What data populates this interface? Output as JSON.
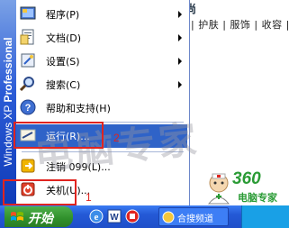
{
  "window": {
    "title": ""
  },
  "background_page": {
    "title_fragment": "尚",
    "nav_text": "| 护肤 | 服饰 | 收容 | 发型"
  },
  "start_menu": {
    "banner": {
      "brand": "Windows XP",
      "edition": "Professional"
    },
    "items": [
      {
        "label": "程序(P)",
        "icon": "programs-icon",
        "submenu": true
      },
      {
        "label": "文档(D)",
        "icon": "documents-icon",
        "submenu": true
      },
      {
        "label": "设置(S)",
        "icon": "settings-icon",
        "submenu": true
      },
      {
        "label": "搜索(C)",
        "icon": "search-icon",
        "submenu": true
      },
      {
        "label": "帮助和支持(H)",
        "icon": "help-icon",
        "submenu": false
      },
      {
        "label": "运行(R)...",
        "icon": "run-icon",
        "submenu": false,
        "selected": true
      },
      {
        "label": "注销 099(L)...",
        "icon": "logoff-icon",
        "submenu": false
      },
      {
        "label": "关机(U)...",
        "icon": "shutdown-icon",
        "submenu": false
      }
    ]
  },
  "annotations": {
    "step1": "1",
    "step2": "2"
  },
  "watermark": "电脑专家",
  "logo": {
    "number": "360",
    "name": "电脑专家"
  },
  "taskbar": {
    "start_label": "开始",
    "task_label": "合搜频道",
    "colors": {
      "taskbar": "#2459d6",
      "start": "#2f8f2b",
      "highlight": "#e0241f"
    }
  }
}
